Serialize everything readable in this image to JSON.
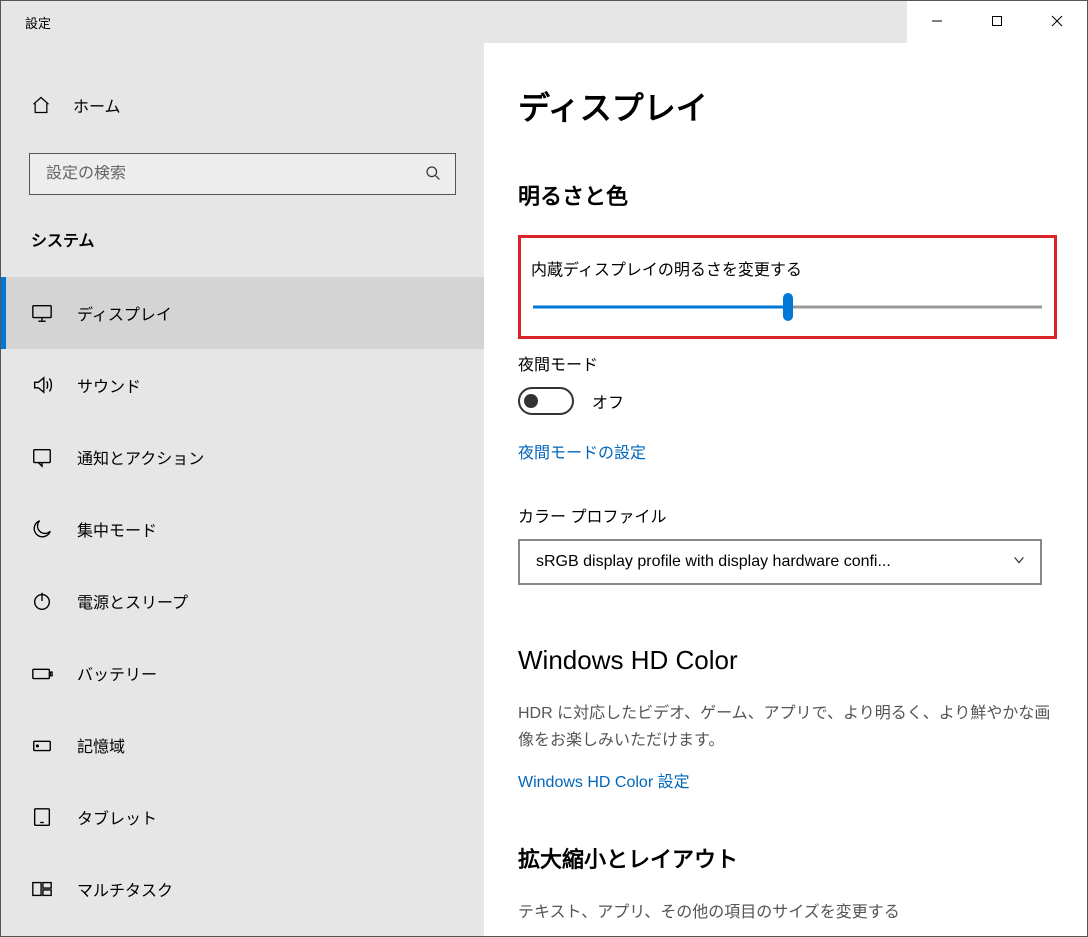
{
  "window": {
    "title": "設定"
  },
  "sidebar": {
    "home_label": "ホーム",
    "search_placeholder": "設定の検索",
    "category": "システム",
    "items": [
      {
        "label": "ディスプレイ",
        "icon": "monitor",
        "active": true
      },
      {
        "label": "サウンド",
        "icon": "sound",
        "active": false
      },
      {
        "label": "通知とアクション",
        "icon": "notification",
        "active": false
      },
      {
        "label": "集中モード",
        "icon": "moon",
        "active": false
      },
      {
        "label": "電源とスリープ",
        "icon": "power",
        "active": false
      },
      {
        "label": "バッテリー",
        "icon": "battery",
        "active": false
      },
      {
        "label": "記憶域",
        "icon": "storage",
        "active": false
      },
      {
        "label": "タブレット",
        "icon": "tablet",
        "active": false
      },
      {
        "label": "マルチタスク",
        "icon": "multitask",
        "active": false
      }
    ]
  },
  "content": {
    "page_title": "ディスプレイ",
    "brightness_section_title": "明るさと色",
    "brightness_label": "内蔵ディスプレイの明るさを変更する",
    "brightness_percent": 50,
    "night_light_label": "夜間モード",
    "night_light_state": "オフ",
    "night_light_link": "夜間モードの設定",
    "color_profile_label": "カラー プロファイル",
    "color_profile_value": "sRGB display profile with display hardware confi...",
    "hd_color_title": "Windows HD Color",
    "hd_color_desc": "HDR に対応したビデオ、ゲーム、アプリで、より明るく、より鮮やかな画像をお楽しみいただけます。",
    "hd_color_link": "Windows HD Color 設定",
    "scale_title": "拡大縮小とレイアウト",
    "cutoff_text": "テキスト、アプリ、その他の項目のサイズを変更する"
  }
}
